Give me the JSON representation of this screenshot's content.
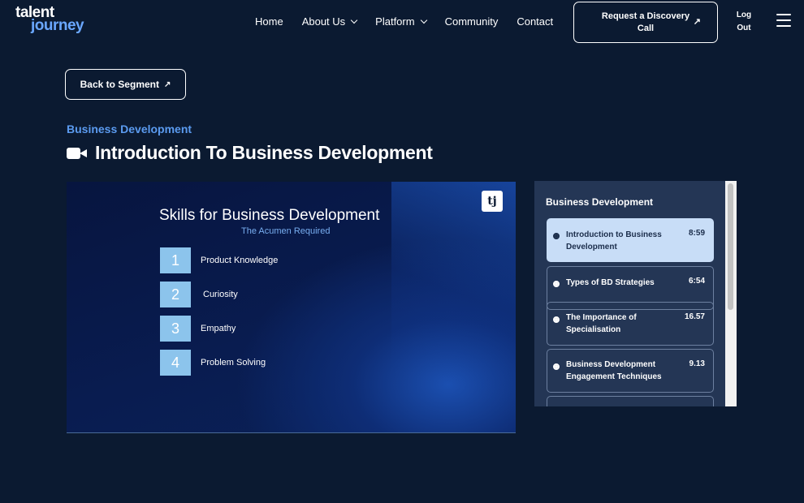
{
  "header": {
    "logo_line1": "talent",
    "logo_line2": "journey",
    "nav": [
      {
        "label": "Home"
      },
      {
        "label": "About Us"
      },
      {
        "label": "Platform"
      },
      {
        "label": "Community"
      },
      {
        "label": "Contact"
      }
    ],
    "cta_label": "Request a Discovery Call",
    "cta_arrow": "↗",
    "logout_line1": "Log",
    "logout_line2": "Out"
  },
  "back_button": {
    "label": "Back to Segment",
    "arrow": "↗"
  },
  "lesson_header": {
    "category": "Business Development",
    "title": "Introduction To Business Development",
    "icon": "video-camera-icon"
  },
  "video": {
    "badge": "tj",
    "slide_title": "Skills for Business Development",
    "slide_subtitle": "The Acumen Required",
    "skills": [
      {
        "num": "1",
        "label": "Product Knowledge"
      },
      {
        "num": "2",
        "label": "Curiosity"
      },
      {
        "num": "3",
        "label": "Empathy"
      },
      {
        "num": "4",
        "label": "Problem Solving"
      }
    ]
  },
  "playlist": {
    "title": "Business Development",
    "lessons": [
      {
        "name": "Introduction to Business Development",
        "duration": "8:59",
        "active": true
      },
      {
        "name": "Types of BD Strategies",
        "duration": "6:54",
        "active": false
      },
      {
        "name": "The Importance of Specialisation",
        "duration": "16.57",
        "active": false
      },
      {
        "name": "Business Development Engagement Techniques",
        "duration": "9.13",
        "active": false
      },
      {
        "name": "",
        "duration": "",
        "active": false
      }
    ]
  },
  "colors": {
    "background": "#0b1a31",
    "accent_blue": "#5b9bf0",
    "active_lesson": "#c8ddf7",
    "playlist_panel": "#243655"
  }
}
